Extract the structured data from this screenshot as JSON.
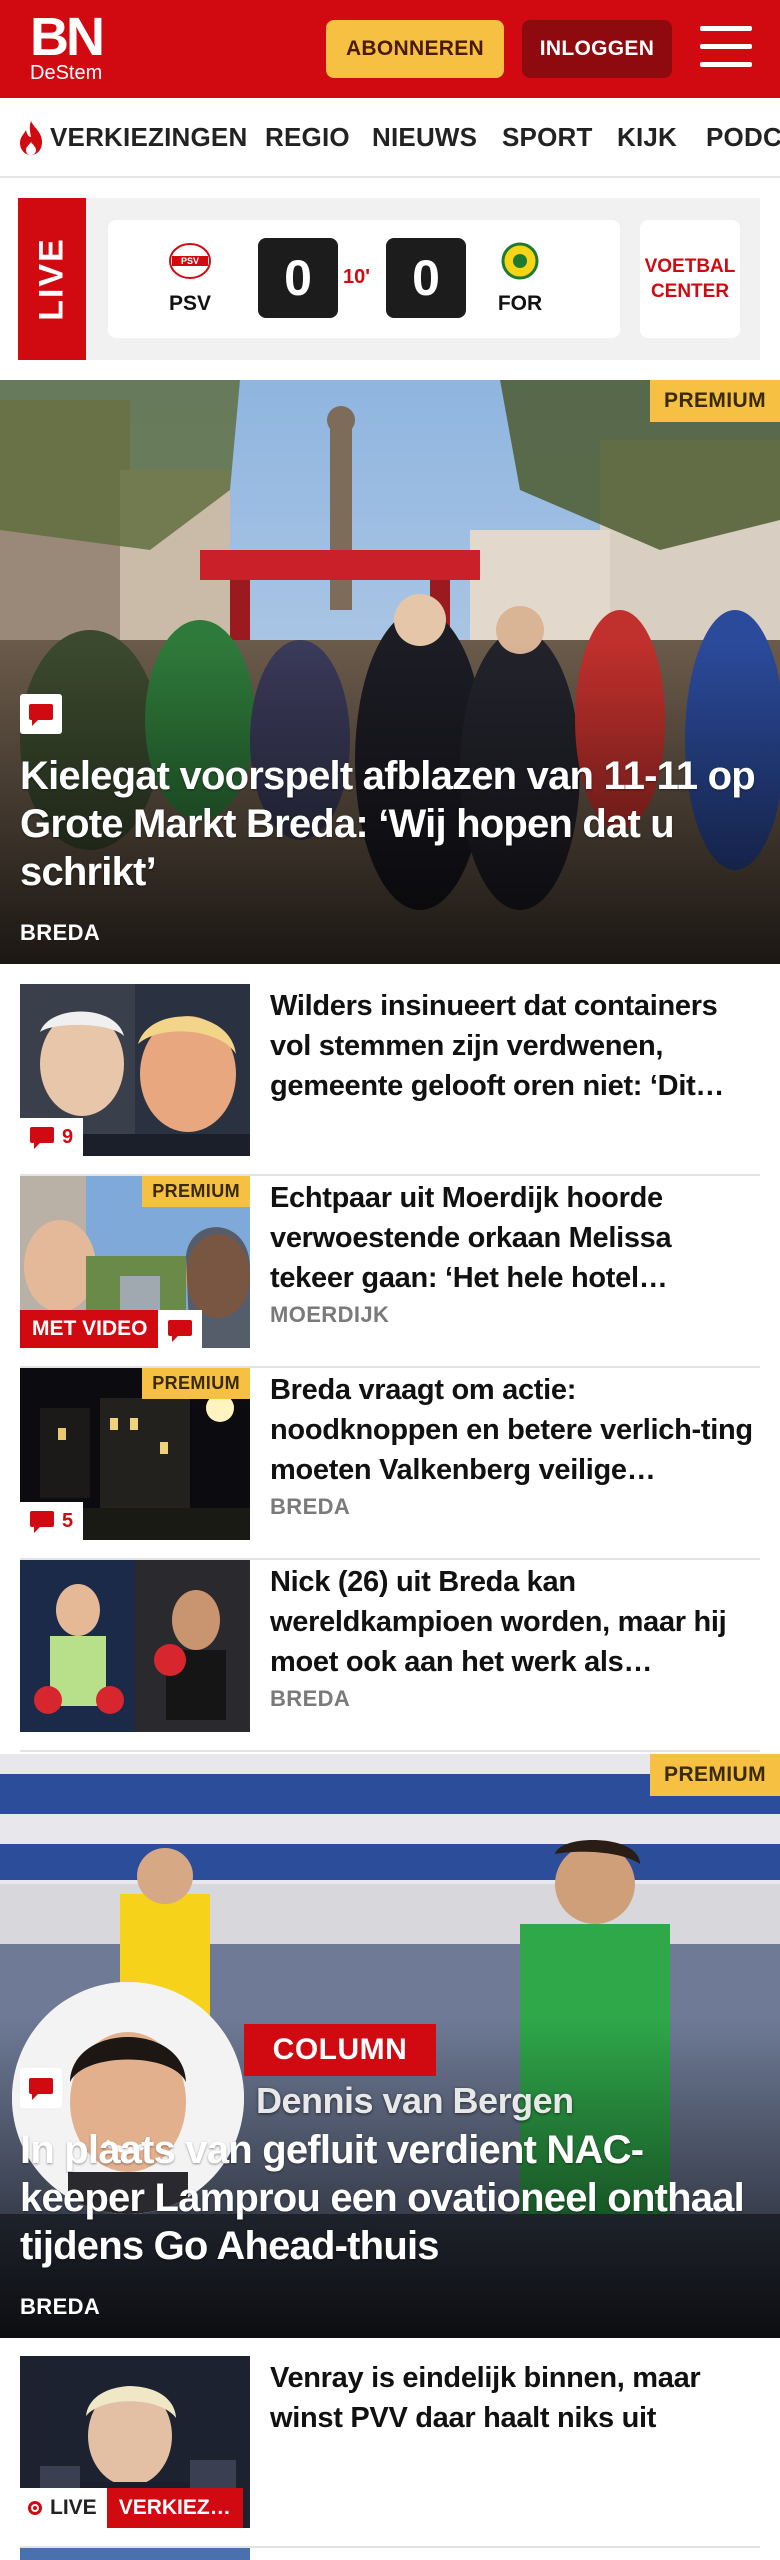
{
  "header": {
    "logo_main": "BN",
    "logo_sub": "DeStem",
    "subscribe_label": "ABONNEREN",
    "login_label": "INLOGGEN",
    "colors": {
      "brand_red": "#d10a11",
      "premium_yellow": "#f6c142",
      "login_dark_red": "#8f0a0e"
    }
  },
  "nav": {
    "items": [
      "VERKIEZINGEN",
      "REGIO",
      "NIEUWS",
      "SPORT",
      "KIJK",
      "PODCAST"
    ]
  },
  "live_widget": {
    "live_label": "LIVE",
    "home_team": "PSV",
    "home_score": "0",
    "away_team": "FOR",
    "away_score": "0",
    "minute": "10'",
    "center_label_line1": "VOETBAL",
    "center_label_line2": "CENTER"
  },
  "hero1": {
    "badge": "PREMIUM",
    "title": "Kielegat voorspelt afblazen van 11-11 op Grote Markt Breda: ‘Wij hopen dat u schrikt’",
    "location": "BREDA"
  },
  "articles": [
    {
      "title": "Wilders insinueert dat containers vol stemmen zijn verdwenen, gemeente gelooft oren niet: ‘Dit…",
      "comments": "9"
    },
    {
      "title": "Echtpaar uit Moerdijk hoorde verwoestende orkaan Melissa tekeer gaan: ‘Het hele hotel…",
      "location": "MOERDIJK",
      "badge": "PREMIUM",
      "video_label": "MET VIDEO"
    },
    {
      "title": "Breda vraagt om actie: noodknoppen en betere verlich-ting moeten Valkenberg veilige…",
      "location": "BREDA",
      "badge": "PREMIUM",
      "comments": "5"
    },
    {
      "title": "Nick (26) uit Breda kan wereldkampioen worden, maar hij moet ook aan het werk als…",
      "location": "BREDA"
    }
  ],
  "hero2": {
    "badge": "PREMIUM",
    "column_label": "COLUMN",
    "author": "Dennis van Bergen",
    "title": "In plaats van gefluit verdient NAC-keeper Lamprou een ovationeel onthaal tijdens Go Ahead-thuis",
    "location": "BREDA"
  },
  "article_last": {
    "title": "Venray is eindelijk binnen, maar winst PVV daar haalt niks uit",
    "live_label": "LIVE",
    "topic_label": "VERKIEZ…"
  },
  "icons": [
    "flame-icon",
    "menu-icon",
    "comment-icon",
    "live-dot-icon",
    "psv-crest-icon",
    "fortuna-crest-icon"
  ]
}
